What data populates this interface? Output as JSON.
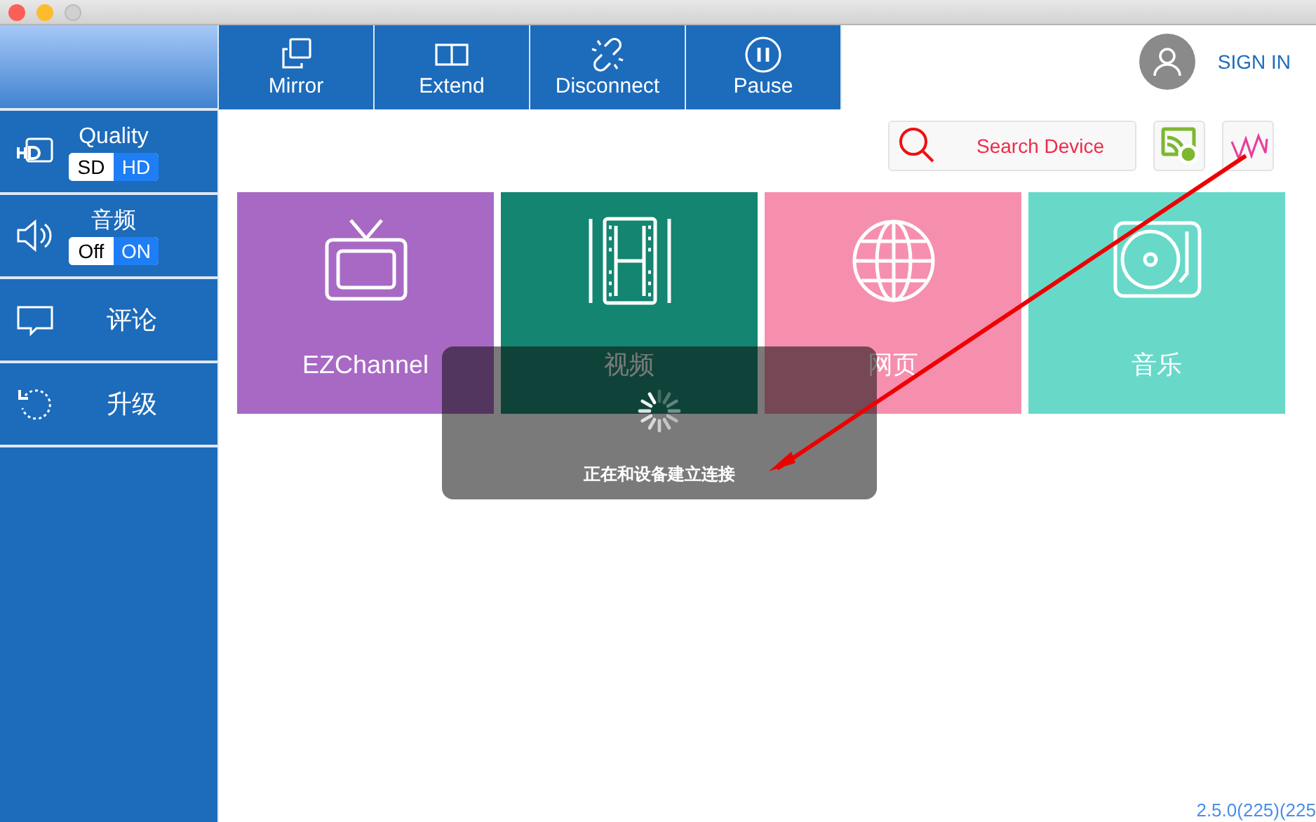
{
  "toolbar": [
    {
      "label": "Mirror"
    },
    {
      "label": "Extend"
    },
    {
      "label": "Disconnect"
    },
    {
      "label": "Pause"
    }
  ],
  "account": {
    "label": "SIGN IN"
  },
  "sidebar": {
    "items": [
      {
        "kind": "toggle",
        "label": "Quality",
        "options": [
          {
            "label": "SD",
            "selected": false
          },
          {
            "label": "HD",
            "selected": true
          }
        ]
      },
      {
        "kind": "toggle",
        "label": "音频",
        "options": [
          {
            "label": "Off",
            "selected": false
          },
          {
            "label": "ON",
            "selected": true
          }
        ]
      },
      {
        "kind": "link",
        "label": "评论"
      },
      {
        "kind": "link",
        "label": "升级"
      }
    ]
  },
  "search": {
    "label": "Search Device"
  },
  "tiles": [
    {
      "label": "EZChannel",
      "color": "#a869c4"
    },
    {
      "label": "视频",
      "color": "#138570"
    },
    {
      "label": "网页",
      "color": "#f68fae"
    },
    {
      "label": "音乐",
      "color": "#68d9c9"
    }
  ],
  "toast": {
    "message": "正在和设备建立连接"
  },
  "version": "2.5.0(225)(225"
}
